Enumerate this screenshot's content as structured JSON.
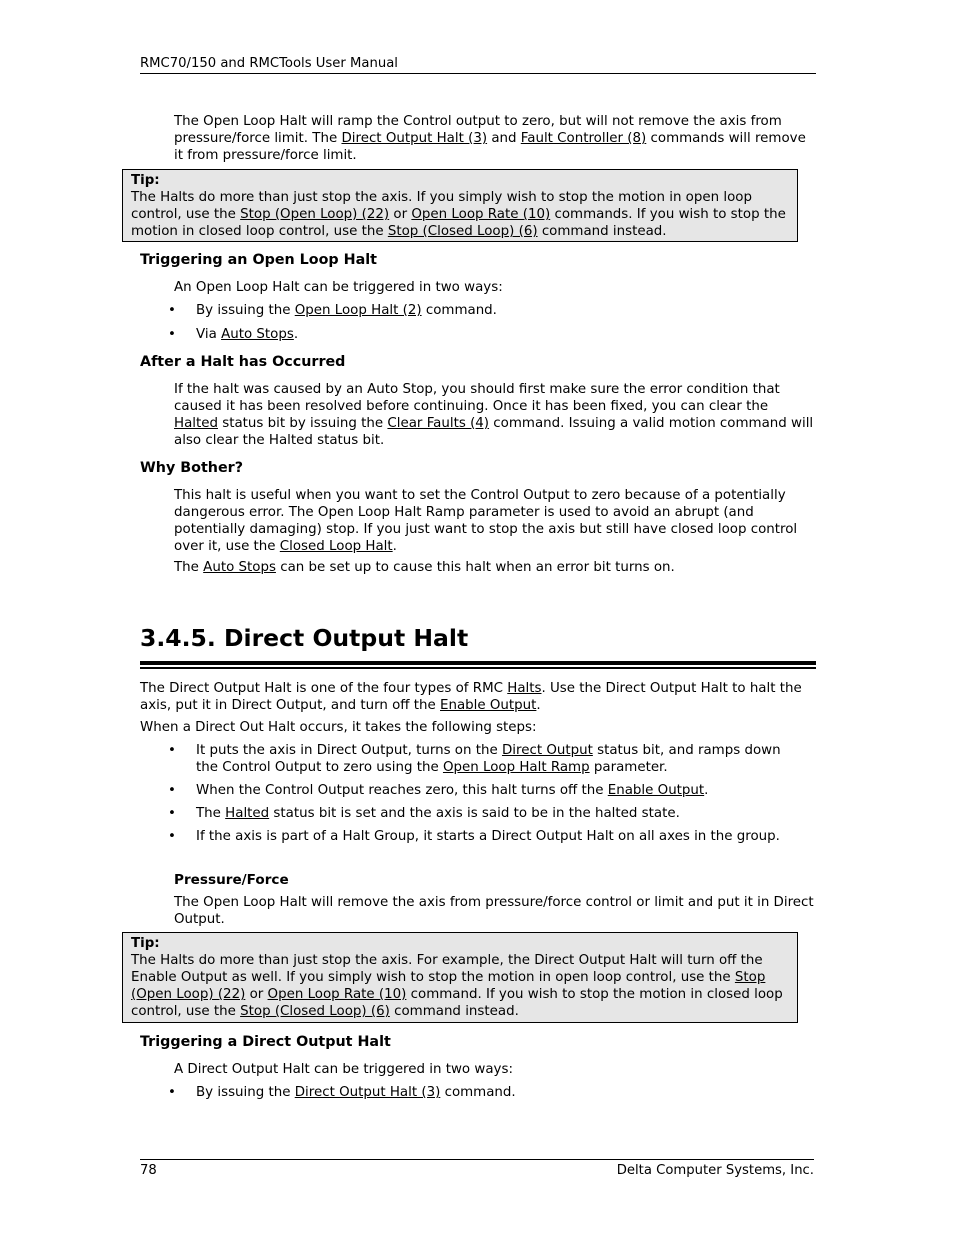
{
  "header": {
    "title": "RMC70/150 and RMCTools User Manual"
  },
  "footer": {
    "page_number": "78",
    "company": "Delta Computer Systems, Inc."
  },
  "intro": {
    "t1": "The Open Loop Halt will ramp the Control output to zero, but will not remove the axis from pressure/force limit. The ",
    "l1": "Direct Output Halt (3)",
    "t2": " and ",
    "l2": "Fault Controller (8)",
    "t3": " commands will remove it from pressure/force limit."
  },
  "tip1": {
    "label": "Tip:",
    "t1": "The Halts do more than just stop the axis. If you simply wish to stop the motion in open loop control, use the ",
    "l1": "Stop (Open Loop) (22)",
    "t2": " or ",
    "l2": "Open Loop Rate (10)",
    "t3": " commands. If you wish to stop the motion in closed loop control, use the ",
    "l3": "Stop (Closed Loop) (6)",
    "t4": " command instead."
  },
  "trigger_ol": {
    "heading": "Triggering an Open Loop Halt",
    "intro": "An Open Loop Halt can be triggered in two ways:",
    "b1_t1": "By issuing the ",
    "b1_l1": "Open Loop Halt (2)",
    "b1_t2": " command.",
    "b2_t1": "Via ",
    "b2_l1": "Auto Stops",
    "b2_t2": "."
  },
  "after": {
    "heading": "After a Halt has Occurred",
    "t1": "If the halt was caused by an Auto Stop, you should first make sure the error condition that caused it has been resolved before continuing. Once it has been fixed, you can clear the ",
    "l1": "Halted",
    "t2": " status bit by issuing the ",
    "l2": "Clear Faults (4)",
    "t3": " command. Issuing a valid motion command will also clear the Halted status bit."
  },
  "why": {
    "heading": "Why Bother?",
    "p1_t1": "This halt is useful when you want to set the Control Output to zero because of a potentially dangerous error. The Open Loop Halt Ramp parameter is used to avoid an abrupt (and potentially damaging) stop. If you just want to stop the axis but still have closed loop control over it, use the ",
    "p1_l1": "Closed Loop Halt",
    "p1_t2": ".",
    "p2_t1": "The ",
    "p2_l1": "Auto Stops",
    "p2_t2": " can be set up to cause this halt when an error bit turns on."
  },
  "section": {
    "title": "3.4.5. Direct Output Halt",
    "p1_t1": "The Direct Output Halt is one of the four types of RMC ",
    "p1_l1": "Halts",
    "p1_t2": ". Use the Direct Output Halt to halt the axis, put it in Direct Output, and turn off the ",
    "p1_l2": "Enable Output",
    "p1_t3": ".",
    "p2": "When a Direct Out Halt occurs, it takes the following steps:",
    "b1_t1": "It puts the axis in Direct Output, turns on the ",
    "b1_l1": "Direct Output",
    "b1_t2": " status bit, and ramps down the Control Output to zero using the ",
    "b1_l2": "Open Loop Halt Ramp",
    "b1_t3": " parameter.",
    "b2_t1": "When the Control Output reaches zero, this halt turns off the ",
    "b2_l1": "Enable Output",
    "b2_t2": ".",
    "b3_t1": "The ",
    "b3_l1": "Halted",
    "b3_t2": " status bit is set and the axis is said to be in the halted state.",
    "b4": "If the axis is part of a Halt Group, it starts a Direct Output Halt on all axes in the group.",
    "pf_heading": "Pressure/Force",
    "pf_text": "The Open Loop Halt will remove the axis from pressure/force control or limit and put it in Direct Output."
  },
  "tip2": {
    "label": "Tip:",
    "t1": "The Halts do more than just stop the axis. For example, the Direct Output Halt will turn off the Enable Output as well. If you simply wish to stop the motion in open loop control, use the ",
    "l1": "Stop (Open Loop) (22)",
    "t2": " or ",
    "l2": "Open Loop Rate (10)",
    "t3": " command. If you wish to stop the motion in closed loop control, use the ",
    "l3": "Stop (Closed Loop) (6)",
    "t4": " command instead."
  },
  "trigger_do": {
    "heading": "Triggering a Direct Output Halt",
    "intro": "A Direct Output Halt can be triggered in two ways:",
    "b1_t1": "By issuing the ",
    "b1_l1": "Direct Output Halt (3)",
    "b1_t2": " command."
  }
}
